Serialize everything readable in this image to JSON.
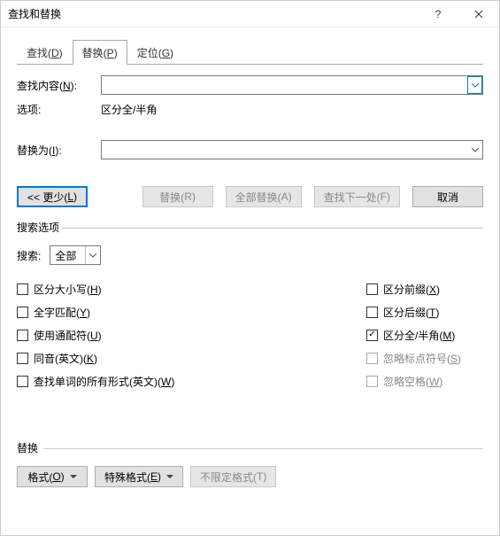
{
  "titlebar": {
    "title": "查找和替换"
  },
  "tabs": [
    {
      "label": "查找(",
      "accel": "D",
      "tail": ")"
    },
    {
      "label": "替换(",
      "accel": "P",
      "tail": ")"
    },
    {
      "label": "定位(",
      "accel": "G",
      "tail": ")"
    }
  ],
  "activeTab": 1,
  "find": {
    "label": "查找内容(",
    "accel": "N",
    "tail": "):",
    "value": ""
  },
  "options_label": "选项:",
  "options_value": "区分全/半角",
  "replace": {
    "label": "替换为(",
    "accel": "I",
    "tail": "):",
    "value": ""
  },
  "buttons": {
    "less": {
      "pre": "<< 更少(",
      "accel": "L",
      "tail": ")"
    },
    "replaceOne": {
      "pre": "替换(",
      "accel": "R",
      "tail": ")"
    },
    "replaceAll": {
      "pre": "全部替换(",
      "accel": "A",
      "tail": ")"
    },
    "findNext": {
      "pre": "查找下一处(",
      "accel": "F",
      "tail": ")"
    },
    "cancel": "取消"
  },
  "search_options_label": "搜索选项",
  "search_label": "搜索:",
  "search_value": "全部",
  "checks_left": [
    {
      "pre": "区分大小写(",
      "accel": "H",
      "tail": ")",
      "checked": false,
      "interactable": true
    },
    {
      "pre": "全字匹配(",
      "accel": "Y",
      "tail": ")",
      "checked": false,
      "interactable": true
    },
    {
      "pre": "使用通配符(",
      "accel": "U",
      "tail": ")",
      "checked": false,
      "interactable": true
    },
    {
      "pre": "同音(英文)(",
      "accel": "K",
      "tail": ")",
      "checked": false,
      "interactable": true
    },
    {
      "pre": "查找单词的所有形式(英文)(",
      "accel": "W",
      "tail": ")",
      "checked": false,
      "interactable": true
    }
  ],
  "checks_right": [
    {
      "pre": "区分前缀(",
      "accel": "X",
      "tail": ")",
      "checked": false,
      "interactable": true
    },
    {
      "pre": "区分后缀(",
      "accel": "T",
      "tail": ")",
      "checked": false,
      "interactable": true
    },
    {
      "pre": "区分全/半角(",
      "accel": "M",
      "tail": ")",
      "checked": true,
      "interactable": true
    },
    {
      "pre": "忽略标点符号(",
      "accel": "S",
      "tail": ")",
      "checked": false,
      "interactable": false
    },
    {
      "pre": "忽略空格(",
      "accel": "W",
      "tail": ")",
      "checked": false,
      "interactable": false
    }
  ],
  "replace_section_label": "替换",
  "bottom": {
    "format": {
      "pre": "格式(",
      "accel": "O",
      "tail": ")"
    },
    "special": {
      "pre": "特殊格式(",
      "accel": "E",
      "tail": ")"
    },
    "nofmt": {
      "pre": "不限定格式(",
      "accel": "T",
      "tail": ")"
    }
  }
}
